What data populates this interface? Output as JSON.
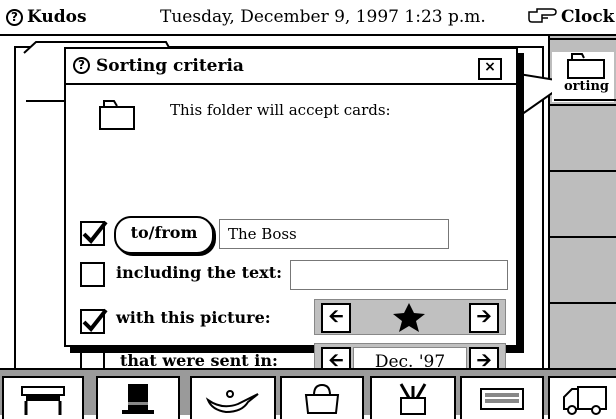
{
  "topbar": {
    "app_name": "Kudos",
    "datetime": "Tuesday, December 9, 1997  1:23 p.m.",
    "right_label": "Clock"
  },
  "side_folder": {
    "label": "orting"
  },
  "dialog": {
    "title": "Sorting criteria",
    "close_label": "×",
    "intro_text": "This folder will accept cards:",
    "criteria": {
      "to_from": {
        "checked": true,
        "button_label": "to/from",
        "value": "The Boss"
      },
      "text": {
        "checked": false,
        "label": "including the text:",
        "value": ""
      },
      "picture": {
        "checked": true,
        "label": "with this picture:",
        "selected_icon": "star-icon"
      },
      "sent_in": {
        "checked": false,
        "label": "that were sent in:",
        "value": "Dec. '97"
      }
    }
  },
  "tray": {
    "items": [
      "desk-icon",
      "top-hat-icon",
      "magic-lamp-icon",
      "handbag-icon",
      "pencil-cup-icon",
      "keyboard-icon",
      "delivery-truck-icon"
    ]
  }
}
